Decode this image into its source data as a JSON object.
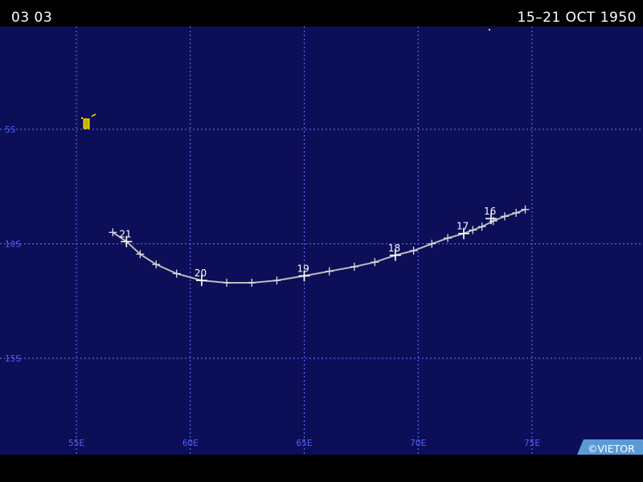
{
  "header": {
    "storm_id": "03 03",
    "date_range": "15–21 OCT 1950"
  },
  "map": {
    "background_color": "#0c0e58",
    "grid_color": "#6a78ff",
    "label_color": "#5060ff",
    "track_color": "#bbbbbb",
    "lon_labels": [
      "55E",
      "60E",
      "65E",
      "70E",
      "75E"
    ],
    "lat_labels": [
      "5S",
      "10S",
      "15S"
    ],
    "track_points": [
      {
        "lon": 74.7,
        "lat": -8.5
      },
      {
        "lon": 74.3,
        "lat": -8.65
      },
      {
        "lon": 73.8,
        "lat": -8.8
      },
      {
        "lon": 73.3,
        "lat": -9.0
      },
      {
        "lon": 72.8,
        "lat": -9.25
      },
      {
        "lon": 72.4,
        "lat": -9.4
      },
      {
        "lon": 72.0,
        "lat": -9.55
      },
      {
        "lon": 71.3,
        "lat": -9.75
      },
      {
        "lon": 70.6,
        "lat": -10.0
      },
      {
        "lon": 69.8,
        "lat": -10.3
      },
      {
        "lon": 69.0,
        "lat": -10.5
      },
      {
        "lon": 68.1,
        "lat": -10.8
      },
      {
        "lon": 67.2,
        "lat": -11.0
      },
      {
        "lon": 66.1,
        "lat": -11.2
      },
      {
        "lon": 65.0,
        "lat": -11.4
      },
      {
        "lon": 63.8,
        "lat": -11.6
      },
      {
        "lon": 62.7,
        "lat": -11.7
      },
      {
        "lon": 61.6,
        "lat": -11.7
      },
      {
        "lon": 60.5,
        "lat": -11.6
      },
      {
        "lon": 59.4,
        "lat": -11.3
      },
      {
        "lon": 58.5,
        "lat": -10.9
      },
      {
        "lon": 57.8,
        "lat": -10.45
      },
      {
        "lon": 57.2,
        "lat": -9.9
      },
      {
        "lon": 56.6,
        "lat": -9.5
      }
    ],
    "day_labels": [
      {
        "text": "16",
        "lon": 73.2,
        "lat": -8.9
      },
      {
        "text": "17",
        "lon": 72.0,
        "lat": -9.55
      },
      {
        "text": "18",
        "lon": 69.0,
        "lat": -10.5
      },
      {
        "text": "19",
        "lon": 65.0,
        "lat": -11.4
      },
      {
        "text": "20",
        "lon": 60.5,
        "lat": -11.6
      },
      {
        "text": "21",
        "lon": 57.2,
        "lat": -9.9
      }
    ],
    "credit": "©VIETOR"
  }
}
